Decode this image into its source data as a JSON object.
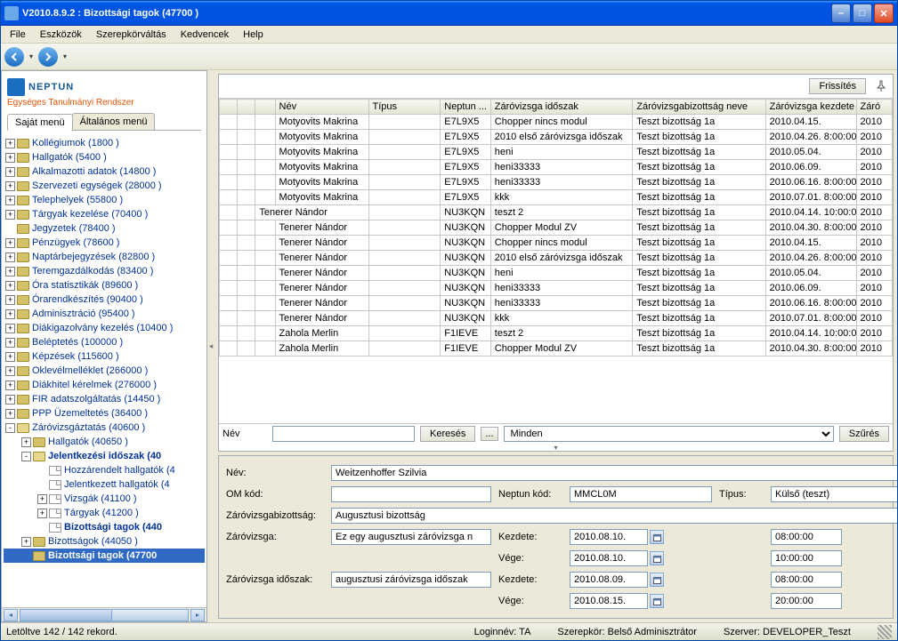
{
  "window": {
    "title": "V2010.8.9.2 : Bizottsági tagok (47700  )"
  },
  "menu": {
    "file": "File",
    "eszkozok": "Eszközök",
    "szerepkor": "Szerepkörváltás",
    "kedvencek": "Kedvencek",
    "help": "Help"
  },
  "logo": {
    "main": "NEPTUN",
    "sub": "Egységes Tanulmányi Rendszer"
  },
  "left_tabs": {
    "sajat": "Saját menü",
    "alt": "Általános menü"
  },
  "tree": [
    {
      "lvl": 0,
      "exp": "+",
      "ico": "folder",
      "label": "Kollégiumok (1800  )"
    },
    {
      "lvl": 0,
      "exp": "+",
      "ico": "folder",
      "label": "Hallgatók (5400  )"
    },
    {
      "lvl": 0,
      "exp": "+",
      "ico": "folder",
      "label": "Alkalmazotti adatok (14800  )"
    },
    {
      "lvl": 0,
      "exp": "+",
      "ico": "folder",
      "label": "Szervezeti egységek (28000  )"
    },
    {
      "lvl": 0,
      "exp": "+",
      "ico": "folder",
      "label": "Telephelyek (55800  )"
    },
    {
      "lvl": 0,
      "exp": "+",
      "ico": "folder",
      "label": "Tárgyak kezelése (70400  )"
    },
    {
      "lvl": 0,
      "exp": " ",
      "ico": "folder",
      "label": "Jegyzetek (78400  )"
    },
    {
      "lvl": 0,
      "exp": "+",
      "ico": "folder",
      "label": "Pénzügyek (78600  )"
    },
    {
      "lvl": 0,
      "exp": "+",
      "ico": "folder",
      "label": "Naptárbejegyzések (82800  )"
    },
    {
      "lvl": 0,
      "exp": "+",
      "ico": "folder",
      "label": "Teremgazdálkodás (83400  )"
    },
    {
      "lvl": 0,
      "exp": "+",
      "ico": "folder",
      "label": "Óra statisztikák (89600  )"
    },
    {
      "lvl": 0,
      "exp": "+",
      "ico": "folder",
      "label": "Órarendkészítés (90400  )"
    },
    {
      "lvl": 0,
      "exp": "+",
      "ico": "folder",
      "label": "Adminisztráció (95400  )"
    },
    {
      "lvl": 0,
      "exp": "+",
      "ico": "folder",
      "label": "Diákigazolvány kezelés (10400  )"
    },
    {
      "lvl": 0,
      "exp": "+",
      "ico": "folder",
      "label": "Beléptetés (100000  )"
    },
    {
      "lvl": 0,
      "exp": "+",
      "ico": "folder",
      "label": "Képzések (115600  )"
    },
    {
      "lvl": 0,
      "exp": "+",
      "ico": "folder",
      "label": "Oklevélmelléklet (266000  )"
    },
    {
      "lvl": 0,
      "exp": "+",
      "ico": "folder",
      "label": "Diákhitel kérelmek (276000  )"
    },
    {
      "lvl": 0,
      "exp": "+",
      "ico": "folder",
      "label": "FIR adatszolgáltatás (14450  )"
    },
    {
      "lvl": 0,
      "exp": "+",
      "ico": "folder",
      "label": "PPP Üzemeltetés (36400  )"
    },
    {
      "lvl": 0,
      "exp": "-",
      "ico": "folderop",
      "label": "Záróvizsgáztatás (40600  )"
    },
    {
      "lvl": 1,
      "exp": "+",
      "ico": "folder",
      "label": "Hallgatók (40650  )"
    },
    {
      "lvl": 1,
      "exp": "-",
      "ico": "folderop",
      "label": "Jelentkezési időszak (40",
      "bold": true
    },
    {
      "lvl": 2,
      "exp": " ",
      "ico": "page",
      "label": "Hozzárendelt hallgatók (4"
    },
    {
      "lvl": 2,
      "exp": " ",
      "ico": "page",
      "label": "Jelentkezett hallgatók (4"
    },
    {
      "lvl": 2,
      "exp": "+",
      "ico": "page",
      "label": "Vizsgák (41100  )"
    },
    {
      "lvl": 2,
      "exp": "+",
      "ico": "page",
      "label": "Tárgyak (41200  )"
    },
    {
      "lvl": 2,
      "exp": " ",
      "ico": "page",
      "label": "Bizottsági tagok (440",
      "bold": true
    },
    {
      "lvl": 1,
      "exp": "+",
      "ico": "folder",
      "label": "Bizottságok (44050  )"
    },
    {
      "lvl": 1,
      "exp": " ",
      "ico": "folder",
      "label": "Bizottsági tagok (47700",
      "bold": true,
      "sel": true
    }
  ],
  "grid": {
    "refresh_btn": "Frissítés",
    "headers": {
      "nev": "Név",
      "tipus": "Típus",
      "neptun": "Neptun ...",
      "idoszak": "Záróvizsga időszak",
      "biznev": "Záróvizsgabizottság neve",
      "kezd": "Záróvizsga kezdete",
      "zev": "Záró"
    },
    "rows": [
      {
        "ind": 0,
        "nev": "Motyovits Makrina",
        "tip": "",
        "nep": "E7L9X5",
        "ido": "Chopper nincs modul",
        "biz": "Teszt bizottság 1a",
        "kez": "2010.04.15.",
        "zev": "2010"
      },
      {
        "ind": 0,
        "nev": "Motyovits Makrina",
        "tip": "",
        "nep": "E7L9X5",
        "ido": "2010 első záróvizsga időszak",
        "biz": "Teszt bizottság 1a",
        "kez": "2010.04.26. 8:00:00",
        "zev": "2010"
      },
      {
        "ind": 0,
        "nev": "Motyovits Makrina",
        "tip": "",
        "nep": "E7L9X5",
        "ido": "heni",
        "biz": "Teszt bizottság 1a",
        "kez": "2010.05.04.",
        "zev": "2010"
      },
      {
        "ind": 0,
        "nev": "Motyovits Makrina",
        "tip": "",
        "nep": "E7L9X5",
        "ido": "heni33333",
        "biz": "Teszt bizottság 1a",
        "kez": "2010.06.09.",
        "zev": "2010"
      },
      {
        "ind": 0,
        "nev": "Motyovits Makrina",
        "tip": "",
        "nep": "E7L9X5",
        "ido": "heni33333",
        "biz": "Teszt bizottság 1a",
        "kez": "2010.06.16. 8:00:00",
        "zev": "2010"
      },
      {
        "ind": 0,
        "nev": "Motyovits Makrina",
        "tip": "",
        "nep": "E7L9X5",
        "ido": "kkk",
        "biz": "Teszt bizottság 1a",
        "kez": "2010.07.01. 8:00:00",
        "zev": "2010"
      },
      {
        "ind": 0,
        "grp": true,
        "nev": "Tenerer Nándor",
        "tip": "",
        "nep": "NU3KQN",
        "ido": "teszt 2",
        "biz": "Teszt bizottság 1a",
        "kez": "2010.04.14. 10:00:0",
        "zev": "2010"
      },
      {
        "ind": 1,
        "nev": "Tenerer Nándor",
        "tip": "",
        "nep": "NU3KQN",
        "ido": "Chopper Modul ZV",
        "biz": "Teszt bizottság 1a",
        "kez": "2010.04.30. 8:00:00",
        "zev": "2010"
      },
      {
        "ind": 1,
        "nev": "Tenerer Nándor",
        "tip": "",
        "nep": "NU3KQN",
        "ido": "Chopper nincs modul",
        "biz": "Teszt bizottság 1a",
        "kez": "2010.04.15.",
        "zev": "2010"
      },
      {
        "ind": 1,
        "nev": "Tenerer Nándor",
        "tip": "",
        "nep": "NU3KQN",
        "ido": "2010 első záróvizsga időszak",
        "biz": "Teszt bizottság 1a",
        "kez": "2010.04.26. 8:00:00",
        "zev": "2010"
      },
      {
        "ind": 1,
        "nev": "Tenerer Nándor",
        "tip": "",
        "nep": "NU3KQN",
        "ido": "heni",
        "biz": "Teszt bizottság 1a",
        "kez": "2010.05.04.",
        "zev": "2010"
      },
      {
        "ind": 1,
        "nev": "Tenerer Nándor",
        "tip": "",
        "nep": "NU3KQN",
        "ido": "heni33333",
        "biz": "Teszt bizottság 1a",
        "kez": "2010.06.09.",
        "zev": "2010"
      },
      {
        "ind": 1,
        "nev": "Tenerer Nándor",
        "tip": "",
        "nep": "NU3KQN",
        "ido": "heni33333",
        "biz": "Teszt bizottság 1a",
        "kez": "2010.06.16. 8:00:00",
        "zev": "2010"
      },
      {
        "ind": 1,
        "nev": "Tenerer Nándor",
        "tip": "",
        "nep": "NU3KQN",
        "ido": "kkk",
        "biz": "Teszt bizottság 1a",
        "kez": "2010.07.01. 8:00:00",
        "zev": "2010"
      },
      {
        "ind": 0,
        "nev": "Zahola Merlin",
        "tip": "",
        "nep": "F1IEVE",
        "ido": "teszt 2",
        "biz": "Teszt bizottság 1a",
        "kez": "2010.04.14. 10:00:0",
        "zev": "2010"
      },
      {
        "ind": 0,
        "nev": "Zahola Merlin",
        "tip": "",
        "nep": "F1IEVE",
        "ido": "Chopper Modul ZV",
        "biz": "Teszt bizottság 1a",
        "kez": "2010.04.30. 8:00:00",
        "zev": "2010"
      }
    ]
  },
  "search": {
    "label": "Név",
    "keres": "Keresés",
    "dots": "...",
    "minden": "Minden",
    "szures": "Szűrés"
  },
  "detail": {
    "nev_lbl": "Név:",
    "nev": "Weitzenhoffer Szilvia",
    "om_lbl": "OM kód:",
    "om": "",
    "neptun_lbl": "Neptun kód:",
    "neptun": "MMCL0M",
    "tipus_lbl": "Típus:",
    "tipus": "Külső (teszt)",
    "biz_lbl": "Záróvizsgabizottság:",
    "biz": "Augusztusi bizottság",
    "zv_lbl": "Záróvizsga:",
    "zv": "Ez egy augusztusi záróvizsga n",
    "kezdete_lbl": "Kezdete:",
    "zv_kezd_d": "2010.08.10.",
    "zv_kezd_t": "08:00:00",
    "vege_lbl": "Vége:",
    "zv_vege_d": "2010.08.10.",
    "zv_vege_t": "10:00:00",
    "ido_lbl": "Záróvizsga időszak:",
    "ido": "augusztusi záróvizsga időszak",
    "ido_kezd_d": "2010.08.09.",
    "ido_kezd_t": "08:00:00",
    "ido_vege_d": "2010.08.15.",
    "ido_vege_t": "20:00:00"
  },
  "status": {
    "left": "Letöltve 142 / 142 rekord.",
    "login": "Loginnév: TA",
    "role": "Szerepkör: Belső Adminisztrátor",
    "server": "Szerver: DEVELOPER_Teszt"
  }
}
